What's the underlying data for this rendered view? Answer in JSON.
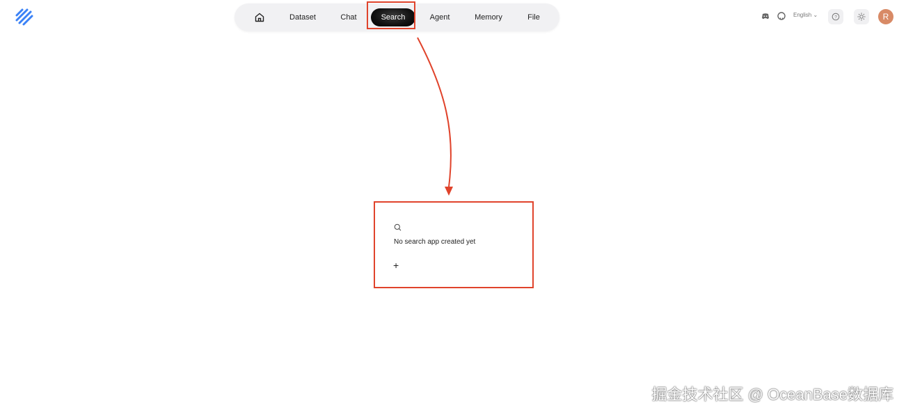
{
  "colors": {
    "accent": "#e0432b",
    "logo": "#3b82f6",
    "nav_active_bg": "#111111",
    "avatar_bg": "#d88a66"
  },
  "header": {
    "logo_icon": "ragflow-logo",
    "nav": [
      {
        "id": "home",
        "label": "",
        "icon": "home-icon"
      },
      {
        "id": "dataset",
        "label": "Dataset"
      },
      {
        "id": "chat",
        "label": "Chat"
      },
      {
        "id": "search",
        "label": "Search",
        "active": true
      },
      {
        "id": "agent",
        "label": "Agent"
      },
      {
        "id": "memory",
        "label": "Memory"
      },
      {
        "id": "file",
        "label": "File"
      }
    ],
    "tools": {
      "discord_icon": "discord-icon",
      "github_icon": "github-icon",
      "language": "English",
      "help_icon": "help-icon",
      "theme_icon": "sun-icon",
      "avatar_initial": "R"
    }
  },
  "empty_state": {
    "icon": "search-icon",
    "message": "No search app created yet",
    "create_label": "+"
  },
  "watermark": "掘金技术社区 @ OceanBase数据库"
}
